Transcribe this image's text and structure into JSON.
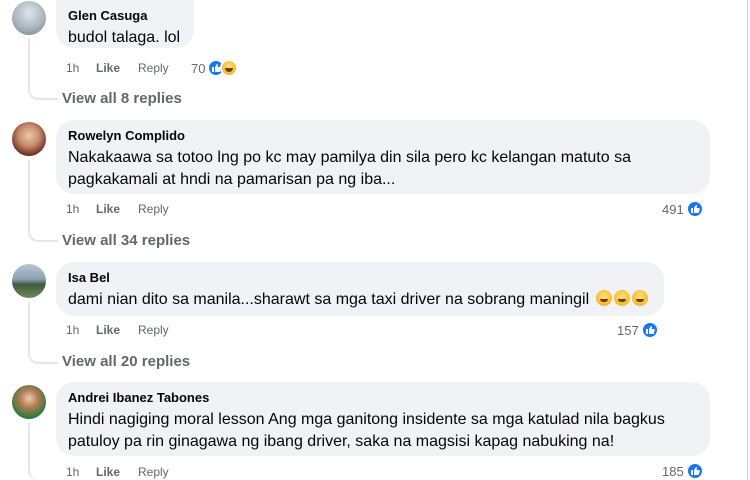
{
  "comments": [
    {
      "author": "Glen Casuga",
      "text": "budol talaga. lol",
      "time": "1h",
      "like_label": "Like",
      "reply_label": "Reply",
      "reaction_count": "70",
      "reactions": [
        "like-icon",
        "haha-icon"
      ],
      "view_replies": "View all 8 replies"
    },
    {
      "author": "Rowelyn Complido",
      "text_line1": "Nakakaawa sa totoo lng po kc may pamilya din sila pero kc kelangan matuto sa",
      "text_line2": "pagkakamali at hndi na pamarisan pa ng iba...",
      "time": "1h",
      "like_label": "Like",
      "reply_label": "Reply",
      "reaction_count": "491",
      "reactions": [
        "like-icon"
      ],
      "view_replies": "View all 34 replies"
    },
    {
      "author": "Isa Bel",
      "text": "dami nian dito sa manila...sharawt sa mga taxi driver na sobrang maningil",
      "time": "1h",
      "like_label": "Like",
      "reply_label": "Reply",
      "reaction_count": "157",
      "reactions": [
        "like-icon"
      ],
      "view_replies": "View all 20 replies"
    },
    {
      "author": "Andrei Ibanez Tabones",
      "text_line1": "Hindi nagiging moral lesson Ang mga ganitong insidente sa mga katulad nila bagkus",
      "text_line2": "patuloy pa rin ginagawa ng ibang driver, saka na magsisi kapag nabuking na!",
      "time": "1h",
      "like_label": "Like",
      "reply_label": "Reply",
      "reaction_count": "185",
      "reactions": [
        "like-icon"
      ]
    }
  ],
  "colors": {
    "bubble": "#f0f2f5",
    "secondary_text": "#65676b",
    "like_blue": "#1877f2"
  }
}
